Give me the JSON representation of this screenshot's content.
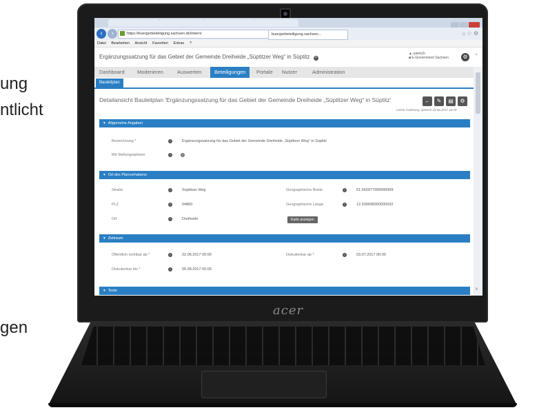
{
  "slide_text": {
    "line1": "ung",
    "line2": "ntlicht",
    "line3": "gen"
  },
  "laptop": {
    "brand": "acer"
  },
  "browser": {
    "tabs": [
      "",
      "",
      "",
      ""
    ],
    "url": "https://buergerbeteiligung.sachsen.de/intern/",
    "active_tab": "buergerbeteiligung.sachsen...",
    "menu": [
      "Datei",
      "Bearbeiten",
      "Ansicht",
      "Favoriten",
      "Extras",
      "?"
    ]
  },
  "app": {
    "title": "Ergänzungssatzung für das Gebiet der Gemeinde Dreiheide „Süptitzer Weg“ in Süptitz",
    "user_name": "rpietsch",
    "user_org": "E-Government Sachsen",
    "nav": [
      "Dashboard",
      "Moderieren",
      "Auswerten",
      "Beteiligungen",
      "Portale",
      "Nutzer",
      "Administration"
    ],
    "nav_active": "Beteiligungen",
    "sub_tab": "Bauleitplan",
    "detail_title": "Detailansicht Bauleitplan 'Ergänzungssatzung für das Gebiet der Gemeinde Dreiheide „Süptitzer Weg“ in Süptitz'",
    "last_change": "Letzte Änderung: rpietsch 19.06.2017 16:28",
    "sections": {
      "allgemein": {
        "title": "Allgemeine Angaben",
        "bezeichnung_label": "Bezeichnung *",
        "bezeichnung_value": "Ergänzungssatzung für das Gebiet der Gemeinde Dreiheide „Süptitzer Weg“ in Süptitz",
        "stellungnahmen_label": "Mit Stellungnahmen"
      },
      "ort": {
        "title": "Ort des Planvorhabens",
        "strasse_label": "Straße",
        "strasse_value": "Süptitzer Weg",
        "plz_label": "PLZ",
        "plz_value": "04860",
        "ort_label": "Ort",
        "ort_value": "Dreiheide",
        "breite_label": "Geographische Breite",
        "breite_value": "51.560977999999999",
        "laenge_label": "Geographische Länge",
        "laenge_value": "12.939698300000032",
        "map_button": "Karte anzeigen"
      },
      "zeitraum": {
        "title": "Zeitraum",
        "sichtbar_label": "Öffentlich sichtbar ab *",
        "sichtbar_value": "22.06.2017 00:00",
        "diskutierbar_ab_label": "Diskutierbar ab *",
        "diskutierbar_ab_value": "03.07.2017 00:00",
        "diskutierbar_bis_label": "Diskutierbar bis *",
        "diskutierbar_bis_value": "05.08.2017 00:00"
      },
      "texte": {
        "title": "Texte"
      }
    }
  },
  "colors": {
    "accent": "#2a7fc4",
    "nav_bg": "#e6e6e6",
    "laptop_body": "#1b1b1b"
  }
}
